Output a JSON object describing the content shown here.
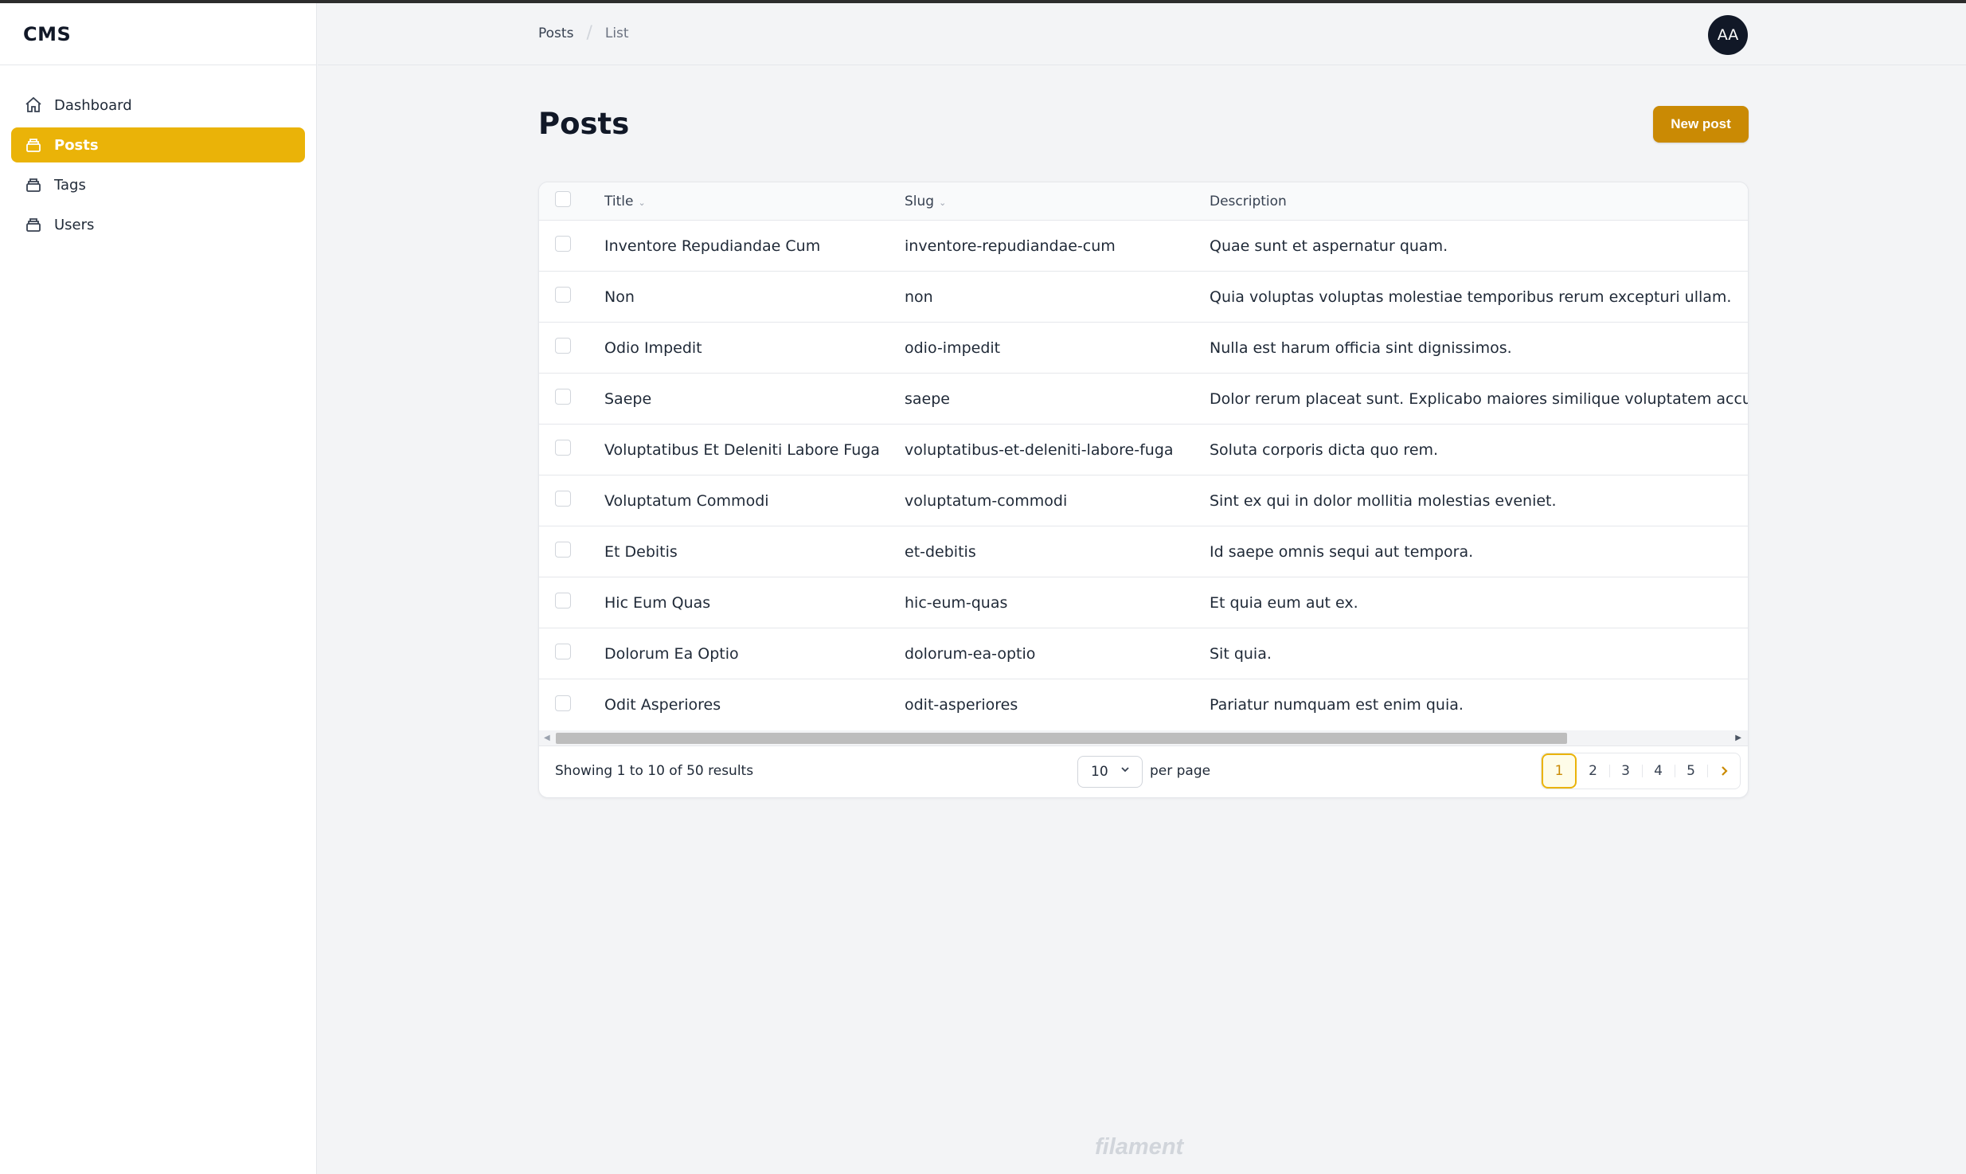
{
  "app": {
    "name": "CMS"
  },
  "sidebar": {
    "items": [
      {
        "label": "Dashboard",
        "icon": "home-icon",
        "active": false
      },
      {
        "label": "Posts",
        "icon": "collection-icon",
        "active": true
      },
      {
        "label": "Tags",
        "icon": "collection-icon",
        "active": false
      },
      {
        "label": "Users",
        "icon": "collection-icon",
        "active": false
      }
    ]
  },
  "header": {
    "breadcrumb": [
      "Posts",
      "List"
    ],
    "avatar_initials": "AA"
  },
  "page": {
    "title": "Posts",
    "new_button": "New post"
  },
  "table": {
    "columns": [
      "Title",
      "Slug",
      "Description"
    ],
    "rows": [
      {
        "title": "Inventore Repudiandae Cum",
        "slug": "inventore-repudiandae-cum",
        "description": "Quae sunt et aspernatur quam."
      },
      {
        "title": "Non",
        "slug": "non",
        "description": "Quia voluptas voluptas molestiae temporibus rerum excepturi ullam."
      },
      {
        "title": "Odio Impedit",
        "slug": "odio-impedit",
        "description": "Nulla est harum officia sint dignissimos."
      },
      {
        "title": "Saepe",
        "slug": "saepe",
        "description": "Dolor rerum placeat sunt. Explicabo maiores similique voluptatem accusa"
      },
      {
        "title": "Voluptatibus Et Deleniti Labore Fuga",
        "slug": "voluptatibus-et-deleniti-labore-fuga",
        "description": "Soluta corporis dicta quo rem."
      },
      {
        "title": "Voluptatum Commodi",
        "slug": "voluptatum-commodi",
        "description": "Sint ex qui in dolor mollitia molestias eveniet."
      },
      {
        "title": "Et Debitis",
        "slug": "et-debitis",
        "description": "Id saepe omnis sequi aut tempora."
      },
      {
        "title": "Hic Eum Quas",
        "slug": "hic-eum-quas",
        "description": "Et quia eum aut ex."
      },
      {
        "title": "Dolorum Ea Optio",
        "slug": "dolorum-ea-optio",
        "description": "Sit quia."
      },
      {
        "title": "Odit Asperiores",
        "slug": "odit-asperiores",
        "description": "Pariatur numquam est enim quia."
      }
    ]
  },
  "pagination": {
    "results_text": "Showing 1 to 10 of 50 results",
    "per_page_value": "10",
    "per_page_label": "per page",
    "pages": [
      "1",
      "2",
      "3",
      "4",
      "5"
    ],
    "current_page": "1",
    "next": "›"
  },
  "footer": {
    "brand": "filament"
  },
  "colors": {
    "accent": "#eab308",
    "button": "#ca8a04"
  }
}
